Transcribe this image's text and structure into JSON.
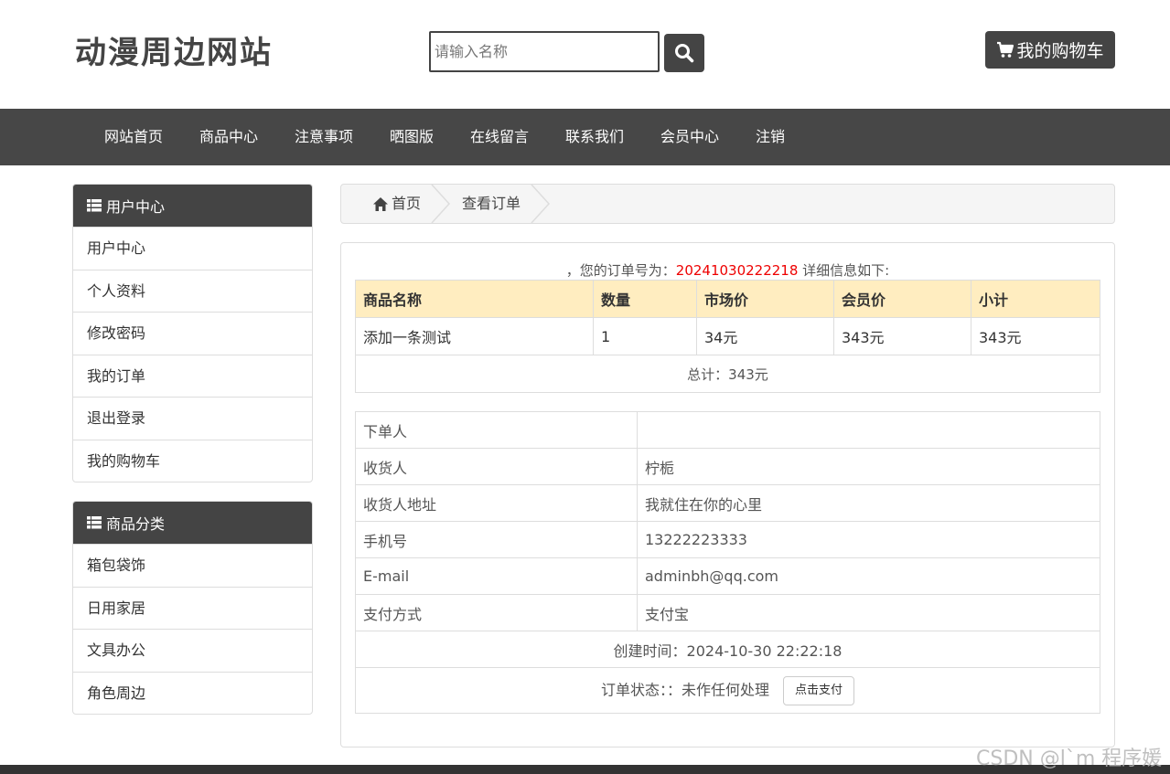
{
  "header": {
    "site_title": "动漫周边网站",
    "search_placeholder": "请输入名称",
    "cart_label": "我的购物车"
  },
  "nav": {
    "items": [
      "网站首页",
      "商品中心",
      "注意事项",
      "晒图版",
      "在线留言",
      "联系我们",
      "会员中心",
      "注销"
    ]
  },
  "sidebar": {
    "user_center": {
      "title": "用户中心",
      "items": [
        "用户中心",
        "个人资料",
        "修改密码",
        "我的订单",
        "退出登录",
        "我的购物车"
      ]
    },
    "categories": {
      "title": "商品分类",
      "items": [
        "箱包袋饰",
        "日用家居",
        "文具办公",
        "角色周边"
      ]
    }
  },
  "breadcrumb": {
    "home": "首页",
    "current": "查看订单"
  },
  "order": {
    "intro_prefix": "，您的订单号为：",
    "order_number": "20241030222218",
    "intro_suffix": " 详细信息如下:",
    "columns": [
      "商品名称",
      "数量",
      "市场价",
      "会员价",
      "小计"
    ],
    "rows": [
      [
        "添加一条测试",
        "1",
        "34元",
        "343元",
        "343元"
      ]
    ],
    "total": "总计：343元",
    "info": {
      "orderer_label": "下单人",
      "orderer_value": "",
      "receiver_label": "收货人",
      "receiver_value": "柠栀",
      "address_label": "收货人地址",
      "address_value": "我就住在你的心里",
      "phone_label": "手机号",
      "phone_value": "13222223333",
      "email_label": "E-mail",
      "email_value": "adminbh@qq.com",
      "payment_label": "支付方式",
      "payment_value": "支付宝"
    },
    "created_time": "创建时间：2024-10-30 22:22:18",
    "status": "订单状态：：未作任何处理",
    "pay_button": "点击支付"
  },
  "watermark": "CSDN @l`m 程序媛",
  "colors": {
    "dark": "#474747",
    "table_header": "#ffedc0",
    "order_number": "#ee0000"
  }
}
